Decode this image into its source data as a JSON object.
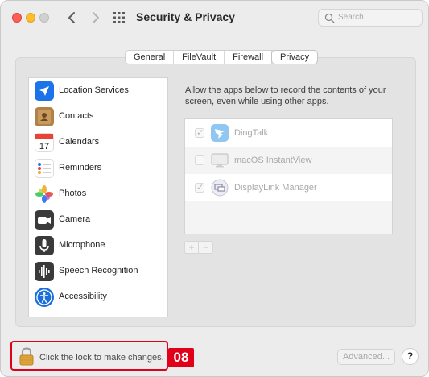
{
  "window": {
    "title": "Security & Privacy",
    "search_placeholder": "Search"
  },
  "tabs": [
    {
      "label": "General",
      "active": false
    },
    {
      "label": "FileVault",
      "active": false
    },
    {
      "label": "Firewall",
      "active": false
    },
    {
      "label": "Privacy",
      "active": true
    }
  ],
  "sidebar": {
    "items": [
      {
        "label": "Location Services",
        "icon": "location-arrow-icon",
        "color": "#1a73e8"
      },
      {
        "label": "Contacts",
        "icon": "contacts-icon",
        "color": "#a0753f"
      },
      {
        "label": "Calendars",
        "icon": "calendar-icon",
        "day": "17",
        "month_color": "#e94237"
      },
      {
        "label": "Reminders",
        "icon": "reminders-icon"
      },
      {
        "label": "Photos",
        "icon": "photos-icon"
      },
      {
        "label": "Camera",
        "icon": "camera-icon",
        "color": "#3a3a3a"
      },
      {
        "label": "Microphone",
        "icon": "microphone-icon",
        "color": "#3a3a3a"
      },
      {
        "label": "Speech Recognition",
        "icon": "speech-waveform-icon",
        "color": "#3a3a3a"
      },
      {
        "label": "Accessibility",
        "icon": "accessibility-icon",
        "color": "#1a6fd8"
      }
    ]
  },
  "main": {
    "description": "Allow the apps below to record the contents of your screen, even while using other apps.",
    "apps": [
      {
        "name": "DingTalk",
        "checked": true,
        "icon": "dingtalk-icon"
      },
      {
        "name": "macOS InstantView",
        "checked": false,
        "icon": "monitor-icon"
      },
      {
        "name": "DisplayLink Manager",
        "checked": true,
        "icon": "displaylink-icon"
      }
    ],
    "add_label": "+",
    "remove_label": "−"
  },
  "footer": {
    "lock_text": "Click the lock to make changes.",
    "badge": "08",
    "advanced_label": "Advanced...",
    "help_label": "?"
  }
}
